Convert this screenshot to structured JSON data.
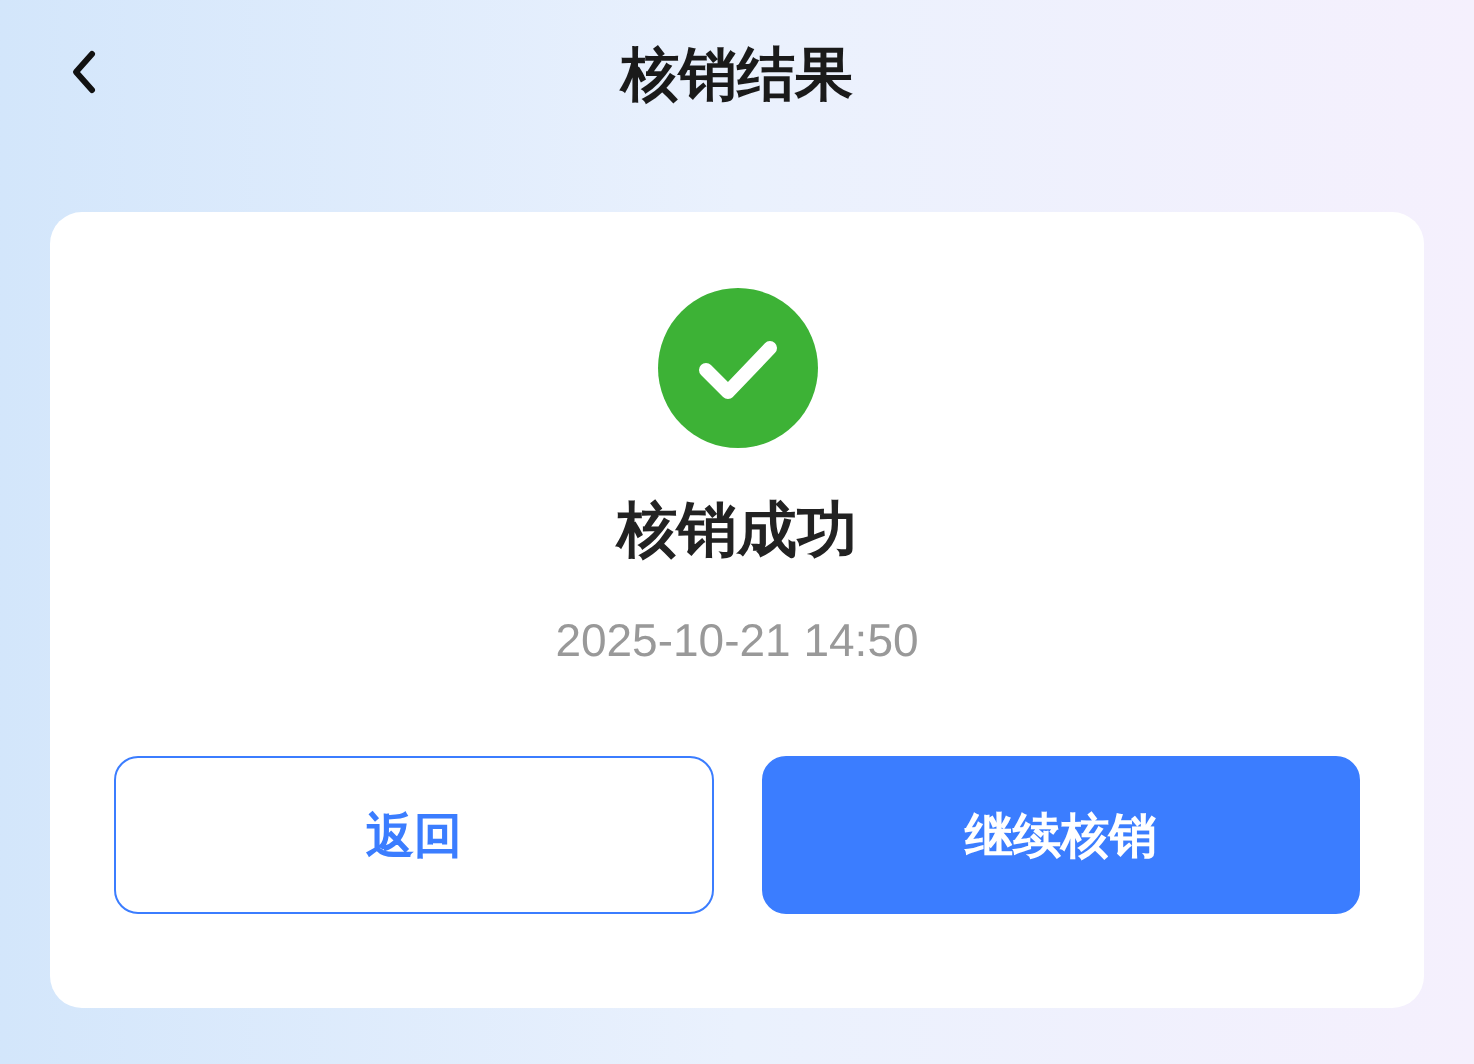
{
  "header": {
    "title": "核销结果"
  },
  "result": {
    "success": true,
    "title": "核销成功",
    "time": "2025-10-21 14:50"
  },
  "buttons": [
    {
      "label": "返回",
      "kind": "secondary"
    },
    {
      "label": "继续核销",
      "kind": "primary"
    }
  ]
}
